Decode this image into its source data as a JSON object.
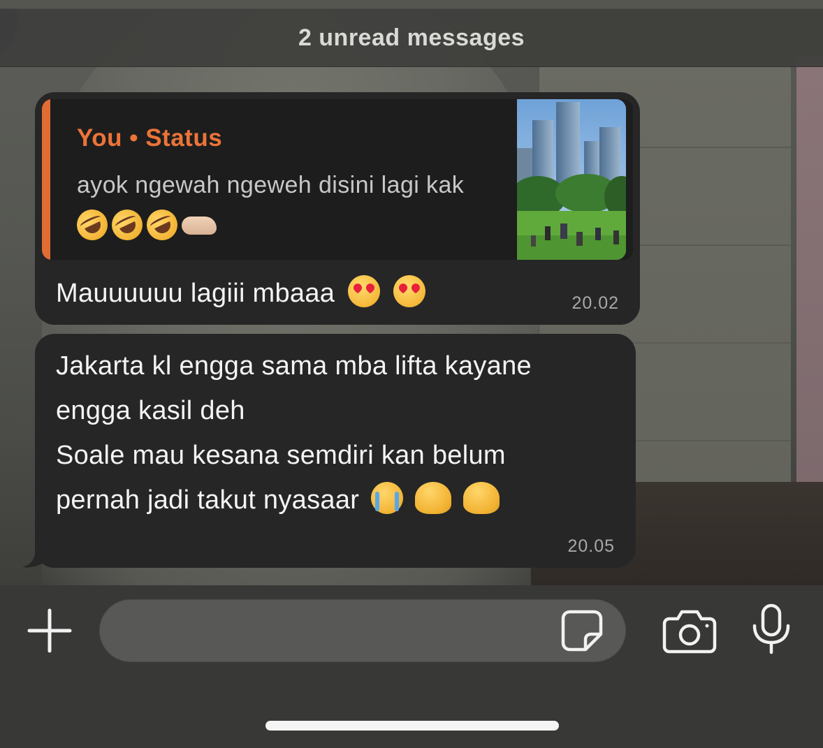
{
  "banner": {
    "unread_label": "2 unread messages"
  },
  "messages": [
    {
      "quote": {
        "title": "You • Status",
        "text": "ayok ngewah ngeweh disini lagi kak",
        "emojis": [
          "rofl-emoji",
          "rofl-emoji",
          "rofl-emoji",
          "pointing-left-hand-emoji"
        ],
        "thumbnail": "city-park-photo"
      },
      "text": "Mauuuuuu lagiii mbaaa",
      "emojis": [
        "heart-eyes-emoji",
        "heart-eyes-emoji"
      ],
      "time": "20.02"
    },
    {
      "lines": [
        "Jakarta kl engga sama mba lifta kayane",
        "engga kasil deh",
        "Soale mau kesana semdiri kan belum",
        "pernah jadi takut nyasaar"
      ],
      "emojis": [
        "crying-emoji",
        "melting-face-emoji",
        "melting-face-emoji"
      ],
      "time": "20.05"
    }
  ],
  "composer": {
    "value": "",
    "placeholder": "",
    "icons": [
      "plus-icon",
      "sticker-icon",
      "camera-icon",
      "microphone-icon"
    ]
  },
  "colors": {
    "bubble": "#262626",
    "quote_accent": "#e36b34",
    "quote_title": "#ec7438",
    "input_bar": "#383837"
  }
}
